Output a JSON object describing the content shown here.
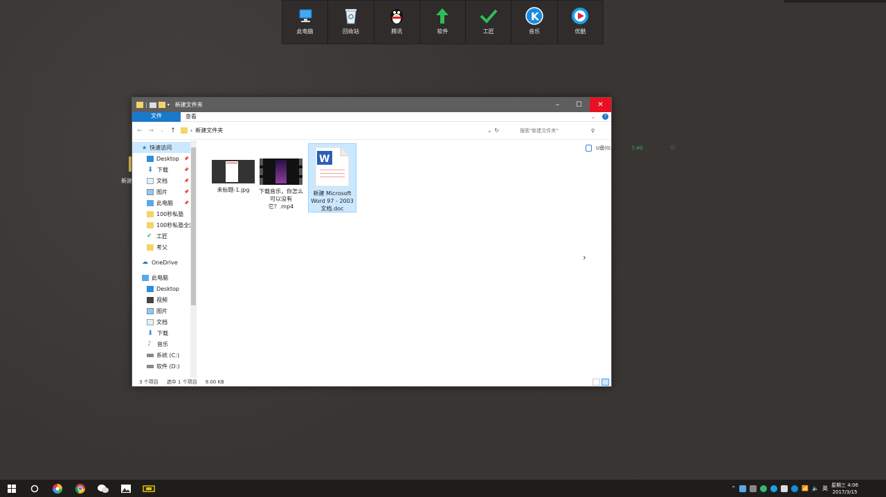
{
  "dock": {
    "items": [
      {
        "label": "此电脑",
        "icon": "computer-icon"
      },
      {
        "label": "回收站",
        "icon": "recycle-bin-icon"
      },
      {
        "label": "腾讯",
        "icon": "qq-penguin-icon"
      },
      {
        "label": "软件",
        "icon": "green-arrow-icon"
      },
      {
        "label": "工匠",
        "icon": "green-check-icon"
      },
      {
        "label": "音乐",
        "icon": "kugou-icon"
      },
      {
        "label": "优酷",
        "icon": "youku-icon"
      }
    ]
  },
  "desktop": {
    "partial_label": "新建"
  },
  "window": {
    "title": "新建文件夹",
    "ribbon_tabs": [
      "文件",
      "主页",
      "共享",
      "查看"
    ],
    "path": "新建文件夹",
    "search_placeholder": "搜索\"新建文件夹\"",
    "nav": {
      "quick_access": "快速访问",
      "quick_items": [
        "Desktop",
        "下载",
        "文档",
        "图片",
        "此电脑",
        "100秒私塾",
        "100秒私塾全部",
        "工匠",
        "考父"
      ],
      "onedrive": "OneDrive",
      "this_pc": "此电脑",
      "pc_items": [
        "Desktop",
        "视频",
        "图片",
        "文档",
        "下载",
        "音乐",
        "系统 (C:)",
        "软件 (D:)"
      ]
    },
    "files": [
      {
        "name": "未标题-1.jpg",
        "type": "image"
      },
      {
        "name": "下载音乐，你怎么可以没有它？.mp4",
        "type": "video"
      },
      {
        "name": "新建 Microsoft Word 97 - 2003 文档.doc",
        "type": "word",
        "selected": true
      }
    ],
    "drive": {
      "label": "U盘(G:)",
      "free_label": "可用",
      "free": "7.4G"
    },
    "status": {
      "count": "3 个项目",
      "selection": "选中 1 个项目",
      "size": "9.00 KB"
    }
  },
  "taskbar": {
    "apps": [
      "start-icon",
      "cortana-icon",
      "app-colorful-icon",
      "chrome-icon",
      "wechat-icon",
      "photos-icon",
      "app-yellow-icon"
    ],
    "ime": "英",
    "time": "星期三 4:06",
    "date": "2017/3/15"
  },
  "colors": {
    "accent": "#1979ca",
    "close": "#e81123",
    "selection": "#cce8ff",
    "folder": "#f5d36b"
  }
}
